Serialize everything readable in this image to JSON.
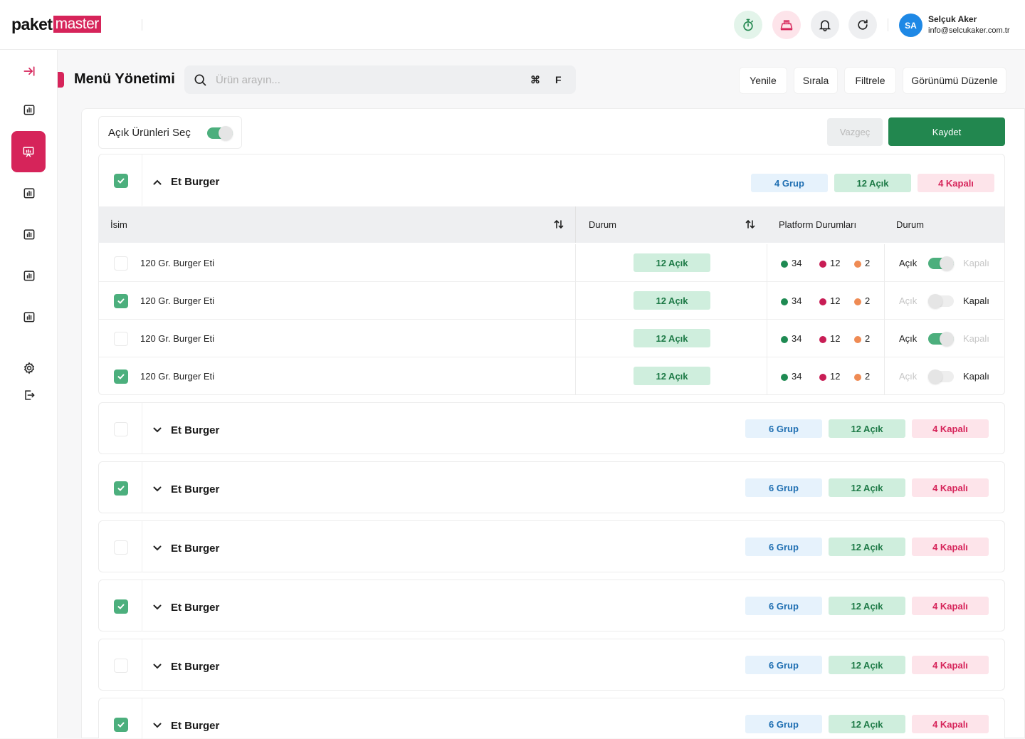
{
  "brand": {
    "part1": "paket",
    "part2": "master"
  },
  "header": {
    "user_initials": "SA",
    "user_name": "Selçuk Aker",
    "user_email": "info@selcukaker.com.tr"
  },
  "page": {
    "title": "Menü Yönetimi",
    "search_placeholder": "Ürün arayın...",
    "shortcut_key1": "⌘",
    "shortcut_key2": "F",
    "toolbar": [
      "Yenile",
      "Sırala",
      "Filtrele",
      "Görünümü Düzenle"
    ]
  },
  "controls": {
    "toggle_label": "Açık Ürünleri Seç",
    "toggle_on": true,
    "cancel_label": "Vazgeç",
    "save_label": "Kaydet"
  },
  "table": {
    "headers": {
      "name": "İsim",
      "status": "Durum",
      "platform": "Platform Durumları",
      "state": "Durum"
    },
    "on_label": "Açık",
    "off_label": "Kapalı"
  },
  "groups": [
    {
      "name": "Et Burger",
      "checked": true,
      "expanded": true,
      "group_badge": "4 Grup",
      "open_badge": "12 Açık",
      "closed_badge": "4 Kapalı",
      "rows": [
        {
          "name": "120 Gr. Burger Eti",
          "checked": false,
          "status": "12 Açık",
          "p_green": "34",
          "p_red": "12",
          "p_orange": "2",
          "open": true
        },
        {
          "name": "120 Gr. Burger Eti",
          "checked": true,
          "status": "12 Açık",
          "p_green": "34",
          "p_red": "12",
          "p_orange": "2",
          "open": false
        },
        {
          "name": "120 Gr. Burger Eti",
          "checked": false,
          "status": "12 Açık",
          "p_green": "34",
          "p_red": "12",
          "p_orange": "2",
          "open": true
        },
        {
          "name": "120 Gr. Burger Eti",
          "checked": true,
          "status": "12 Açık",
          "p_green": "34",
          "p_red": "12",
          "p_orange": "2",
          "open": false
        }
      ]
    },
    {
      "name": "Et Burger",
      "checked": false,
      "expanded": false,
      "group_badge": "6 Grup",
      "open_badge": "12 Açık",
      "closed_badge": "4 Kapalı"
    },
    {
      "name": "Et Burger",
      "checked": true,
      "expanded": false,
      "group_badge": "6 Grup",
      "open_badge": "12 Açık",
      "closed_badge": "4 Kapalı"
    },
    {
      "name": "Et Burger",
      "checked": false,
      "expanded": false,
      "group_badge": "6 Grup",
      "open_badge": "12 Açık",
      "closed_badge": "4 Kapalı"
    },
    {
      "name": "Et Burger",
      "checked": true,
      "expanded": false,
      "group_badge": "6 Grup",
      "open_badge": "12 Açık",
      "closed_badge": "4 Kapalı"
    },
    {
      "name": "Et Burger",
      "checked": false,
      "expanded": false,
      "group_badge": "6 Grup",
      "open_badge": "12 Açık",
      "closed_badge": "4 Kapalı"
    },
    {
      "name": "Et Burger",
      "checked": true,
      "expanded": false,
      "group_badge": "6 Grup",
      "open_badge": "12 Açık",
      "closed_badge": "4 Kapalı"
    }
  ],
  "colors": {
    "brand": "#d6245a",
    "success": "#22874f",
    "toggle_on": "#4caf7d",
    "dot_green": "#1e8a52",
    "dot_red": "#c81d55",
    "dot_orange": "#ef8b54"
  }
}
